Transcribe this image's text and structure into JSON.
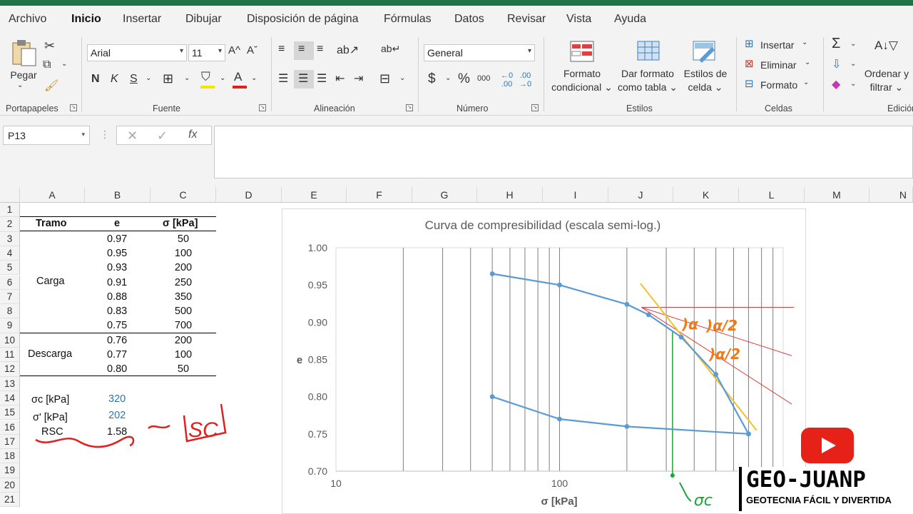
{
  "menu": {
    "items": [
      "Archivo",
      "Inicio",
      "Insertar",
      "Dibujar",
      "Disposición de página",
      "Fórmulas",
      "Datos",
      "Revisar",
      "Vista",
      "Ayuda"
    ]
  },
  "ribbon": {
    "clipboard": {
      "paste_label": "Pegar",
      "group_label": "Portapapeles"
    },
    "font": {
      "family": "Arial",
      "size": "11",
      "bold": "N",
      "italic": "K",
      "underline": "S",
      "group_label": "Fuente",
      "font_color": "#e02020",
      "highlight_color": "#f5e600"
    },
    "alignment": {
      "group_label": "Alineación"
    },
    "number": {
      "format": "General",
      "currency": "$",
      "percent": "%",
      "thousands": "000",
      "group_label": "Número"
    },
    "styles": {
      "conditional_line1": "Formato",
      "conditional_line2": "condicional",
      "table_line1": "Dar formato",
      "table_line2": "como tabla",
      "cell_line1": "Estilos de",
      "cell_line2": "celda",
      "group_label": "Estilos"
    },
    "cells": {
      "insert": "Insertar",
      "delete": "Eliminar",
      "format": "Formato",
      "group_label": "Celdas"
    },
    "editing": {
      "sort_line1": "Ordenar y",
      "sort_line2": "filtrar",
      "group_label": "Edición"
    }
  },
  "formula_bar": {
    "name_box": "P13",
    "fx": "fx",
    "value": ""
  },
  "columns": [
    "A",
    "B",
    "C",
    "D",
    "E",
    "F",
    "G",
    "H",
    "I",
    "J",
    "K",
    "L",
    "M",
    "N"
  ],
  "rows": [
    "1",
    "2",
    "3",
    "4",
    "5",
    "6",
    "7",
    "8",
    "9",
    "10",
    "11",
    "12",
    "13",
    "14",
    "15",
    "16",
    "17",
    "18",
    "19",
    "20",
    "21"
  ],
  "table": {
    "headers": [
      "Tramo",
      "e",
      "σ [kPa]"
    ],
    "carga_label": "Carga",
    "descarga_label": "Descarga",
    "e_values": [
      "0.97",
      "0.95",
      "0.93",
      "0.91",
      "0.88",
      "0.83",
      "0.75",
      "0.76",
      "0.77",
      "0.80"
    ],
    "sigma_values": [
      "50",
      "100",
      "200",
      "250",
      "350",
      "500",
      "700",
      "200",
      "100",
      "50"
    ]
  },
  "results": {
    "sigma_c_label": "σc [kPa]",
    "sigma_c_value": "320",
    "sigma_prime_label": "σ' [kPa]",
    "sigma_prime_value": "202",
    "rsc_label": "RSC",
    "rsc_value": "1.58",
    "annotation": "~SC"
  },
  "chart_data": {
    "type": "scatter",
    "title": "Curva de compresibilidad (escala semi-log.)",
    "xlabel": "σ [kPa]",
    "ylabel": "e",
    "x_scale": "log",
    "xlim": [
      10,
      1000
    ],
    "ylim": [
      0.7,
      1.0
    ],
    "y_ticks": [
      "1.00",
      "0.95",
      "0.90",
      "0.85",
      "0.80",
      "0.75",
      "0.70"
    ],
    "x_ticks": [
      "10",
      "100"
    ],
    "series": [
      {
        "x": [
          50,
          100,
          200,
          250,
          350,
          500,
          700
        ],
        "y": [
          0.965,
          0.95,
          0.924,
          0.91,
          0.88,
          0.83,
          0.75
        ]
      },
      {
        "x": [
          700,
          200,
          100,
          50
        ],
        "y": [
          0.75,
          0.76,
          0.77,
          0.8
        ]
      }
    ],
    "annotations": {
      "alpha": "α",
      "alpha_half_1": "α/2",
      "alpha_half_2": "α/2",
      "sigma_c": "σc"
    },
    "colors": {
      "series": "#5b9bd5",
      "tangent": "#f2c12e",
      "construction": "#e04040",
      "projection": "#1fa33a",
      "handwriting": "#f07a1a"
    }
  },
  "brand": {
    "name": "GEO-JUANP",
    "tagline": "GEOTECNIA FÁCIL Y DIVERTIDA",
    "play_color": "#e62117"
  }
}
